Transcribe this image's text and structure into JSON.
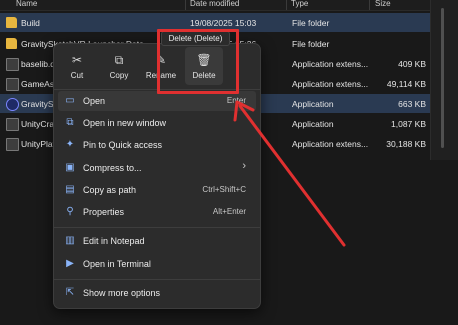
{
  "columns": [
    "Name",
    "Date modified",
    "Type",
    "Size"
  ],
  "files": [
    {
      "name": "Build",
      "date": "19/08/2025 15:03",
      "type": "File folder",
      "size": "",
      "icon": "folder-icon",
      "selected": true
    },
    {
      "name": "GravitySketchVR Launcher Data",
      "date": "19/08/2025 15:26",
      "type": "File folder",
      "size": "",
      "icon": "folder-icon",
      "selected": false
    },
    {
      "name": "baselib.dll",
      "date": "",
      "type": "Application extens...",
      "size": "409 KB",
      "icon": "dll-icon",
      "selected": false
    },
    {
      "name": "GameAssembly.dll",
      "date": "",
      "type": "Application extens...",
      "size": "49,114 KB",
      "icon": "dll-icon",
      "selected": false
    },
    {
      "name": "GravitySketchVR.exe",
      "date": "",
      "type": "Application",
      "size": "663 KB",
      "icon": "app-icon",
      "selected": true
    },
    {
      "name": "UnityCrashHandler64.exe",
      "date": "",
      "type": "Application",
      "size": "1,087 KB",
      "icon": "app-icon",
      "selected": false
    },
    {
      "name": "UnityPlayer.dll",
      "date": "",
      "type": "Application extens...",
      "size": "30,188 KB",
      "icon": "dll-icon",
      "selected": false
    }
  ],
  "context_menu": {
    "toolbar": [
      {
        "label": "Cut",
        "icon": "✂"
      },
      {
        "label": "Copy",
        "icon": "⧉"
      },
      {
        "label": "Rename",
        "icon": "✎"
      },
      {
        "label": "Delete",
        "icon": "🗑"
      }
    ],
    "tooltip": "Delete (Delete)",
    "items": [
      {
        "label": "Open",
        "shortcut": "Enter",
        "icon": "▭"
      },
      {
        "label": "Open in new window",
        "shortcut": "",
        "icon": "⧉"
      },
      {
        "label": "Pin to Quick access",
        "shortcut": "",
        "icon": "✦"
      },
      {
        "label": "Compress to...",
        "shortcut": "›",
        "icon": "▣"
      },
      {
        "label": "Copy as path",
        "shortcut": "Ctrl+Shift+C",
        "icon": "▤"
      },
      {
        "label": "Properties",
        "shortcut": "Alt+Enter",
        "icon": "⚲"
      },
      {
        "label": "Edit in Notepad",
        "shortcut": "",
        "icon": "▥"
      },
      {
        "label": "Open in Terminal",
        "shortcut": "",
        "icon": "▶"
      },
      {
        "label": "Show more options",
        "shortcut": "",
        "icon": "⇱"
      }
    ]
  },
  "colors": {
    "highlight": "#e03030",
    "accent": "#8ab4f8",
    "folder": "#e7b63f"
  }
}
